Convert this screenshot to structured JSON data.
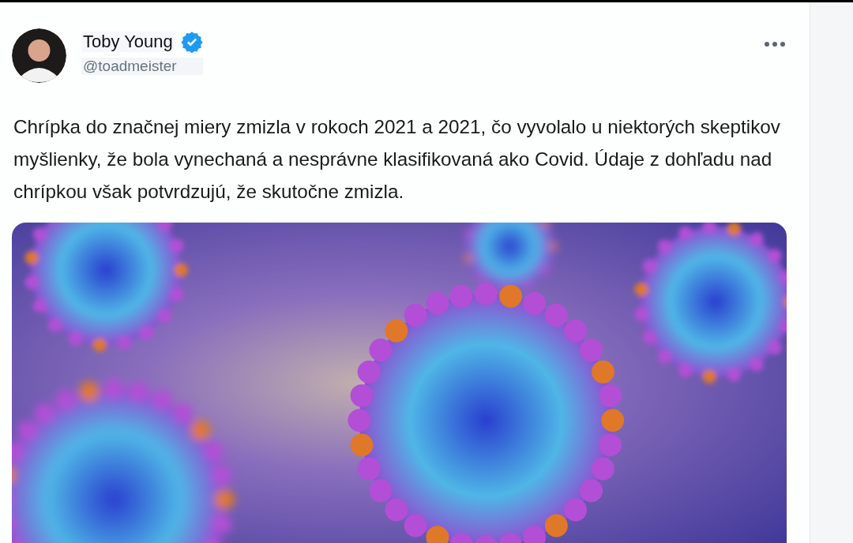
{
  "tweet": {
    "author": {
      "name": "Toby Young",
      "handle": "@toadmeister",
      "verified": true
    },
    "text": "Chrípka do značnej miery zmizla v rokoch 2021 a 2021, čo vyvolalo u niektorých skeptikov myšlienky, že bola vynechaná a nesprávne klasifikovaná ako Covid. Údaje z dohľadu nad chrípkou však potvrdzujú, že skutočne zmizla."
  }
}
